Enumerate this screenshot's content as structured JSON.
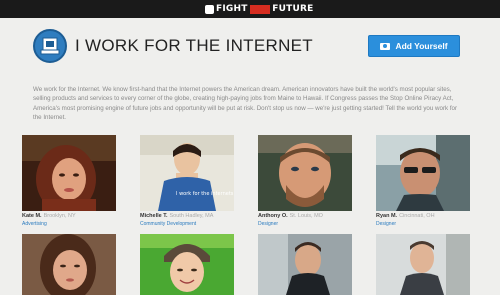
{
  "header": {
    "logo_left": "FIGHT",
    "logo_mid": "FOR",
    "logo_right": "FUTURE"
  },
  "page": {
    "title": "I WORK FOR THE INTERNET",
    "cta_label": "Add Yourself",
    "intro": "We work for the Internet. We know first-hand that the Internet powers the American dream. American innovators have built the world's most popular sites, selling products and services to every corner of the globe, creating high-paying jobs from Maine to Hawaii. If Congress passes the Stop Online Piracy Act, America's most promising engine of future jobs and opportunity will be put at risk. Don't stop us now — we're just getting started! Tell the world you work for the Internet."
  },
  "people": [
    {
      "name": "Kate M.",
      "location": "Brooklyn, NY",
      "role": "Advertising"
    },
    {
      "name": "Michelle T.",
      "location": "South Hadley, MA",
      "role": "Community Development"
    },
    {
      "name": "Anthony O.",
      "location": "St. Louis, MO",
      "role": "Designer"
    },
    {
      "name": "Ryan M.",
      "location": "Cincinnati, OH",
      "role": "Designer"
    },
    {
      "name": "",
      "location": "",
      "role": ""
    },
    {
      "name": "",
      "location": "",
      "role": ""
    },
    {
      "name": "",
      "location": "",
      "role": ""
    },
    {
      "name": "",
      "location": "",
      "role": ""
    }
  ],
  "shirt_text": "I work for the internets",
  "colors": {
    "topbar": "#1a1a1a",
    "accent": "#2b8fdc",
    "badge": "#2f7dbf",
    "link": "#2b7bbf"
  }
}
